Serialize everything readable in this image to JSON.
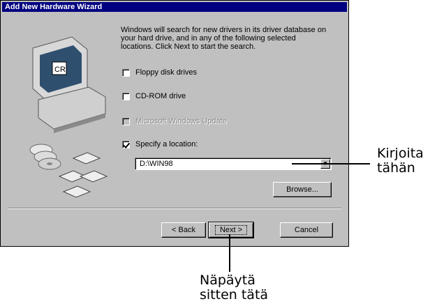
{
  "window": {
    "title": "Add New Hardware Wizard"
  },
  "intro_text": "Windows will search for new drivers in its driver database on your hard drive, and in any of the following selected locations. Click Next to start the search.",
  "options": [
    {
      "label": "Floppy disk drives",
      "checked": false,
      "enabled": true
    },
    {
      "label": "CD-ROM drive",
      "checked": false,
      "enabled": true
    },
    {
      "label": "Microsoft Windows Update",
      "checked": false,
      "enabled": false
    },
    {
      "label": "Specify a location:",
      "checked": true,
      "enabled": true
    }
  ],
  "location": {
    "value": "D:\\WIN98"
  },
  "buttons": {
    "browse": "Browse...",
    "back": "< Back",
    "next": "Next >",
    "cancel": "Cancel"
  },
  "annotations": {
    "type_here": [
      "Kirjoita",
      "tähän"
    ],
    "then_click": [
      "Näpäytä",
      "sitten tätä"
    ]
  }
}
